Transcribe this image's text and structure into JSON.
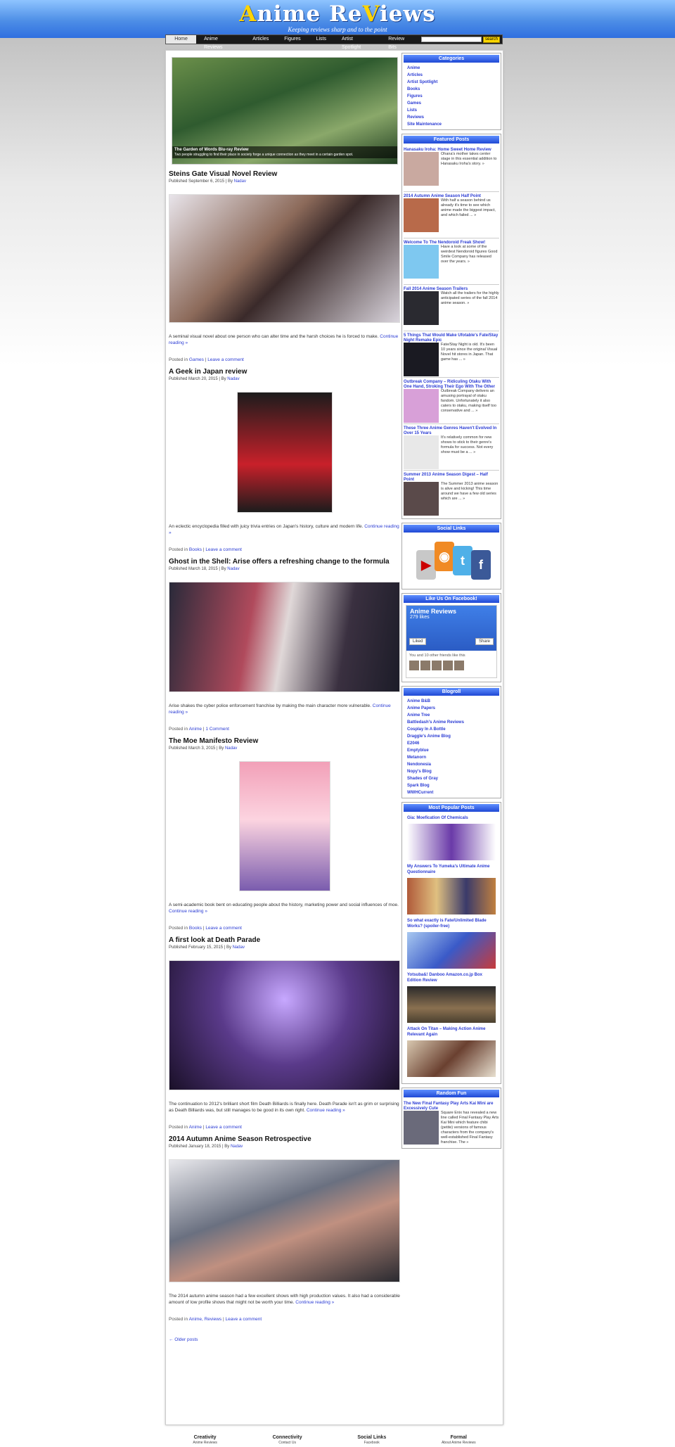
{
  "site": {
    "title_a": "A",
    "title_mid": "nime Re",
    "title_v": "V",
    "title_end": "iews",
    "tagline": "Keeping reviews sharp and to the point"
  },
  "nav": {
    "items": [
      "Home",
      "Anime Reviews",
      "Articles",
      "Figures",
      "Lists",
      "Artist Spotlight",
      "Review Bits"
    ],
    "search_button": "search"
  },
  "slider": {
    "title": "The Garden of Words Blu-ray Review",
    "text": "Two people struggling to find their place in society forge a unique connection as they meet in a certain garden spot."
  },
  "posts": [
    {
      "title": "Steins Gate Visual Novel Review",
      "meta_pub": "Published September 6, 2015 | By ",
      "author": "Nadav",
      "excerpt": "A seminal visual novel about one person who can alter time and the harsh choices he is forced to make.",
      "more": "Continue reading »",
      "posted": "Posted in ",
      "cat": "Games",
      "sep": " | ",
      "comment": "Leave a comment"
    },
    {
      "title": "A Geek in Japan review",
      "meta_pub": "Published March 20, 2015 | By ",
      "author": "Nadav",
      "excerpt": "An eclectic encyclopedia filled with juicy trivia entries on Japan's history, culture and modern life.",
      "more": "Continue reading »",
      "posted": "Posted in ",
      "cat": "Books",
      "sep": " | ",
      "comment": "Leave a comment"
    },
    {
      "title": "Ghost in the Shell: Arise offers a refreshing change to the formula",
      "meta_pub": "Published March 18, 2015 | By ",
      "author": "Nadav",
      "excerpt": "Arise shakes the cyber police enforcement franchise by making the main character more vulnerable.",
      "more": "Continue reading »",
      "posted": "Posted in ",
      "cat": "Anime",
      "sep": " | ",
      "comment": "1 Comment"
    },
    {
      "title": "The Moe Manifesto Review",
      "meta_pub": "Published March 3, 2015 | By ",
      "author": "Nadav",
      "excerpt": "A semi-academic book bent on educating people about the history, marketing power and social influences of moe.",
      "more": "Continue reading »",
      "posted": "Posted in ",
      "cat": "Books",
      "sep": " | ",
      "comment": "Leave a comment"
    },
    {
      "title": "A first look at Death Parade",
      "meta_pub": "Published February 15, 2015 | By ",
      "author": "Nadav",
      "excerpt": "The continuation to 2012's brilliant short film Death Billiards is finally here. Death Parade isn't as grim or surprising as Death Billiards was, but still manages to be good in its own right.",
      "more": "Continue reading »",
      "posted": "Posted in ",
      "cat": "Anime",
      "sep": " | ",
      "comment": "Leave a comment"
    },
    {
      "title": "2014 Autumn Anime Season Retrospective",
      "meta_pub": "Published January 18, 2015 | By ",
      "author": "Nadav",
      "excerpt": "The 2014 autumn anime season had a few excellent shows with high production values. It also had a considerable amount of low profile shows that might not be worth your time.",
      "more": "Continue reading »",
      "posted": "Posted in ",
      "cat": "Anime, Reviews",
      "sep": " | ",
      "comment": "Leave a comment"
    }
  ],
  "older": "← Older posts",
  "sidebar": {
    "categories_title": "Categories",
    "categories": [
      "Anime",
      "Articles",
      "Artist Spotlight",
      "Books",
      "Figures",
      "Games",
      "Lists",
      "Reviews",
      "Site Maintenance"
    ],
    "featured_title": "Featured Posts",
    "featured": [
      {
        "t": "Hanasaku Iroha: Home Sweet Home Review",
        "x": "Ohana's mother takes center stage in this essential addition to Hanasaku Iroha's story. »"
      },
      {
        "t": "2014 Autumn Anime Season Half Point",
        "x": "With half a season behind us already it's time to see which anime made the biggest impact, and which failed ... »"
      },
      {
        "t": "Welcome To The Nendoroid Freak Show!",
        "x": "Have a look at some of the weirdest Nendoroid figures Good Smile Company has released over the years. »"
      },
      {
        "t": "Fall 2014 Anime Season Trailers",
        "x": "Watch all the trailers for the highly anticipated series of the fall 2014 anime season. »"
      },
      {
        "t": "5 Things That Would Make Ufotable's Fate/Stay Night Remake Epic",
        "x": "Fate/Stay Night is old. It's been 10 years since the original Visual Novel hit stores in Japan. That game has ... »"
      },
      {
        "t": "Outbreak Company – Ridiculing Otaku With One Hand, Stroking Their Ego With The Other",
        "x": "Outbreak Company delivers an amusing portrayal of otaku fandom. Unfortunately it also caters to otaku, making itself too conservative and ... »"
      },
      {
        "t": "These Three Anime Genres Haven't Evolved In Over 15 Years",
        "x": "It's relatively common for new shows to stick to their genre's formula for success. Not every show must be a ... »"
      },
      {
        "t": "Summer 2013 Anime Season Digest – Half Point",
        "x": "The Summer 2013 anime season is alive and kicking! This time around we have a few old series which are ... »"
      }
    ],
    "social_title": "Social Links",
    "fb_title": "Like Us On Facebook!",
    "fb_name": "Anime Reviews",
    "fb_likes": "279 likes",
    "fb_like": "Liked",
    "fb_share": "Share",
    "fb_friends": "You and 10 other friends like this",
    "blogroll_title": "Blogroll",
    "blogroll": [
      "Anime B&B",
      "Anime Papers",
      "Anime Tree",
      "Battledash's Anime Reviews",
      "Cosplay In A Bottle",
      "Draggle's Anime Blog",
      "E2046",
      "Emptyblue",
      "Metanorn",
      "Nendonesia",
      "Nopy's Blog",
      "Shades of Gray",
      "Spark Blog",
      "WWHCurrent"
    ],
    "popular_title": "Most Popular Posts",
    "popular": [
      "Gia: Moefication Of Chemicals",
      "My Answers To Yumeka's Ultimate Anime Questionnaire",
      "So what exactly is Fate/Unlimited Blade Works? (spoiler-free)",
      "Yotsuba&! Danboo Amazon.co.jp Box Edition Review",
      "Attack On Titan – Making Action Anime Relevant Again"
    ],
    "random_title": "Random Fun",
    "random": {
      "t": "The New Final Fantasy Play Arts Kai Mini are Excessively Cute",
      "x": "Square Enix has revealed a new line called Final Fantasy Play Arts Kai Mini which feature chibi (petite) versions of famous characters from the company's well-established Final Fantasy franchise. The »"
    }
  },
  "footer": [
    {
      "h": "Creativity",
      "s": "Anime Reviews"
    },
    {
      "h": "Connectivity",
      "s": "Contact Us"
    },
    {
      "h": "Social Links",
      "s": "Facebook"
    },
    {
      "h": "Formal",
      "s": "About Anime Reviews"
    }
  ]
}
